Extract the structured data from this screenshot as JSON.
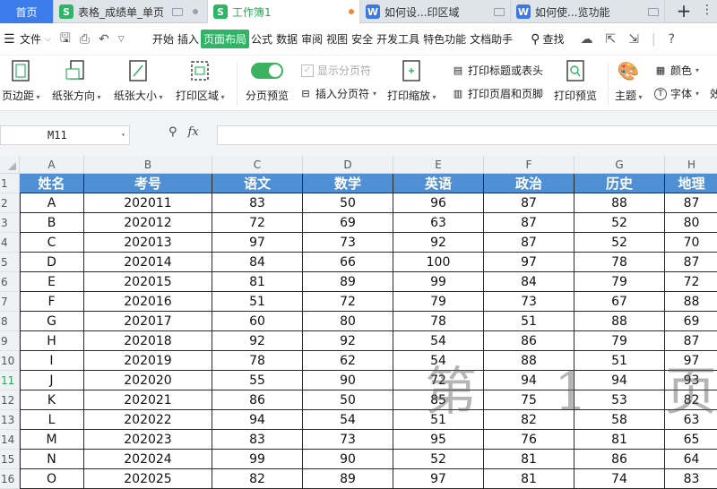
{
  "tabs": [
    {
      "label": "首页",
      "kind": "home"
    },
    {
      "label": "表格_成绩单_单页",
      "kind": "s",
      "state": "gray"
    },
    {
      "label": "工作簿1",
      "kind": "s",
      "state": "active"
    },
    {
      "label": "如何设...印区域",
      "kind": "w",
      "state": "gray"
    },
    {
      "label": "如何使...览功能",
      "kind": "w",
      "state": "gray"
    }
  ],
  "menu": {
    "file_label": "文件",
    "tabs": [
      "开始",
      "插入",
      "页面布局",
      "公式",
      "数据",
      "审阅",
      "视图",
      "安全",
      "开发工具",
      "特色功能",
      "文档助手"
    ],
    "active_tab": "页面布局",
    "find_label": "查找"
  },
  "ribbon": {
    "margins": "页边距",
    "orientation": "纸张方向",
    "size": "纸张大小",
    "print_area": "打印区域",
    "page_break_preview": "分页预览",
    "show_page_breaks": "显示分页符",
    "insert_page_break": "插入分页符",
    "print_scale": "打印缩放",
    "print_titles": "打印标题或表头",
    "header_footer": "打印页眉和页脚",
    "print_preview": "打印预览",
    "theme": "主题",
    "colors": "颜色",
    "fonts": "字体",
    "effects_partial": "效"
  },
  "formula_bar": {
    "cell_ref": "M11",
    "fx_label": "fx",
    "formula": ""
  },
  "sheet": {
    "columns": [
      "A",
      "B",
      "C",
      "D",
      "E",
      "F",
      "G",
      "H"
    ],
    "row_numbers": [
      "1",
      "2",
      "3",
      "4",
      "5",
      "6",
      "7",
      "8",
      "9",
      "10",
      "11",
      "12",
      "13",
      "14",
      "15",
      "16"
    ],
    "active_row": "11",
    "header": [
      "姓名",
      "考号",
      "语文",
      "数学",
      "英语",
      "政治",
      "历史",
      "地理"
    ],
    "rows": [
      [
        "A",
        "202011",
        "83",
        "50",
        "96",
        "87",
        "88",
        "87"
      ],
      [
        "B",
        "202012",
        "72",
        "69",
        "63",
        "87",
        "52",
        "80"
      ],
      [
        "C",
        "202013",
        "97",
        "73",
        "92",
        "87",
        "52",
        "70"
      ],
      [
        "D",
        "202014",
        "84",
        "66",
        "100",
        "97",
        "78",
        "87"
      ],
      [
        "E",
        "202015",
        "81",
        "89",
        "99",
        "84",
        "79",
        "72"
      ],
      [
        "F",
        "202016",
        "51",
        "72",
        "79",
        "73",
        "67",
        "88"
      ],
      [
        "G",
        "202017",
        "60",
        "80",
        "78",
        "51",
        "88",
        "69"
      ],
      [
        "H",
        "202018",
        "92",
        "92",
        "54",
        "86",
        "79",
        "87"
      ],
      [
        "I",
        "202019",
        "78",
        "62",
        "54",
        "88",
        "51",
        "97"
      ],
      [
        "J",
        "202020",
        "55",
        "90",
        "72",
        "94",
        "94",
        "93"
      ],
      [
        "K",
        "202021",
        "86",
        "50",
        "85",
        "75",
        "53",
        "82"
      ],
      [
        "L",
        "202022",
        "94",
        "54",
        "51",
        "82",
        "58",
        "63"
      ],
      [
        "M",
        "202023",
        "83",
        "73",
        "95",
        "76",
        "81",
        "65"
      ],
      [
        "N",
        "202024",
        "99",
        "90",
        "52",
        "81",
        "86",
        "64"
      ],
      [
        "O",
        "202025",
        "82",
        "89",
        "97",
        "81",
        "74",
        "83"
      ]
    ],
    "page_watermark": "第 1 页"
  }
}
